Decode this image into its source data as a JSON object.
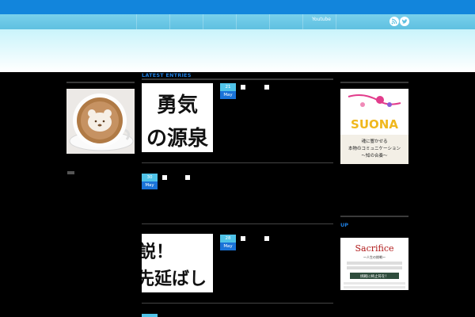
{
  "nav": {
    "youtube_label": "Youtube"
  },
  "main": {
    "section_title": "LATEST ENTRIES",
    "entries": [
      {
        "day": "21",
        "month": "May",
        "thumb_text": "勇気の源泉"
      },
      {
        "day": "30",
        "month": "May",
        "thumb_text": ""
      },
      {
        "day": "28",
        "month": "May",
        "thumb_text": "説！先延ばし"
      }
    ]
  },
  "sidebar_right": {
    "ad1": {
      "brand": "SUONA",
      "line1": "魂に響かせる",
      "line2": "本物のコミュニケーション",
      "line3": "〜知の合奏〜"
    },
    "up_label": "UP",
    "ad2": {
      "brand": "Sacrifice",
      "line1": "〜人生の挑戦〜",
      "button": "挑戦に終止符を！"
    }
  },
  "colors": {
    "accent": "#1e7ee0",
    "topbar": "#1285dc",
    "badge_day": "#4fc3e8",
    "badge_month": "#1a73d8"
  }
}
